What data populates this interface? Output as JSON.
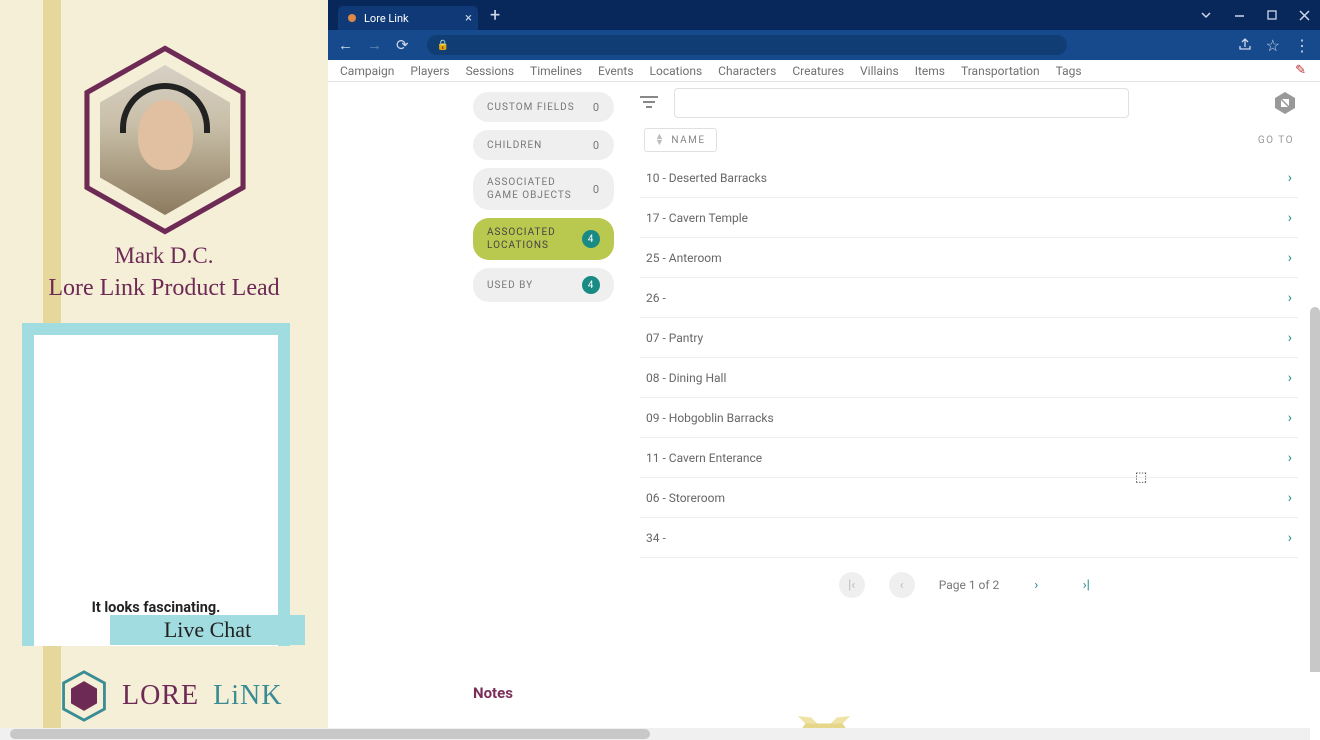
{
  "stream": {
    "presenter_name": "Mark D.C.",
    "presenter_title": "Lore Link Product Lead",
    "chat_message": "It looks fascinating.",
    "chat_label": "Live Chat",
    "brand_word1": "LORE",
    "brand_word2": "LiNK"
  },
  "browser": {
    "tab_title": "Lore Link"
  },
  "menu": {
    "items": [
      "Campaign",
      "Players",
      "Sessions",
      "Timelines",
      "Events",
      "Locations",
      "Characters",
      "Creatures",
      "Villains",
      "Items",
      "Transportation",
      "Tags"
    ]
  },
  "side_tabs": {
    "custom_fields": {
      "label": "Custom Fields",
      "count": "0"
    },
    "children": {
      "label": "Children",
      "count": "0"
    },
    "assoc_objects": {
      "label1": "Associated",
      "label2": "Game Objects",
      "count": "0"
    },
    "assoc_locations": {
      "label1": "Associated",
      "label2": "Locations",
      "count": "4"
    },
    "used_by": {
      "label": "Used By",
      "count": "4"
    }
  },
  "list": {
    "sort_label": "Name",
    "goto_label": "Go To",
    "rows": [
      "10 - Deserted Barracks",
      "17 - Cavern Temple",
      "25 - Anteroom",
      "26 -",
      "07 - Pantry",
      "08 - Dining Hall",
      "09 - Hobgoblin Barracks",
      "11 - Cavern Enterance",
      "06 - Storeroom",
      "34 -"
    ],
    "pager_text": "Page 1 of 2"
  },
  "notes": {
    "header": "Notes"
  }
}
